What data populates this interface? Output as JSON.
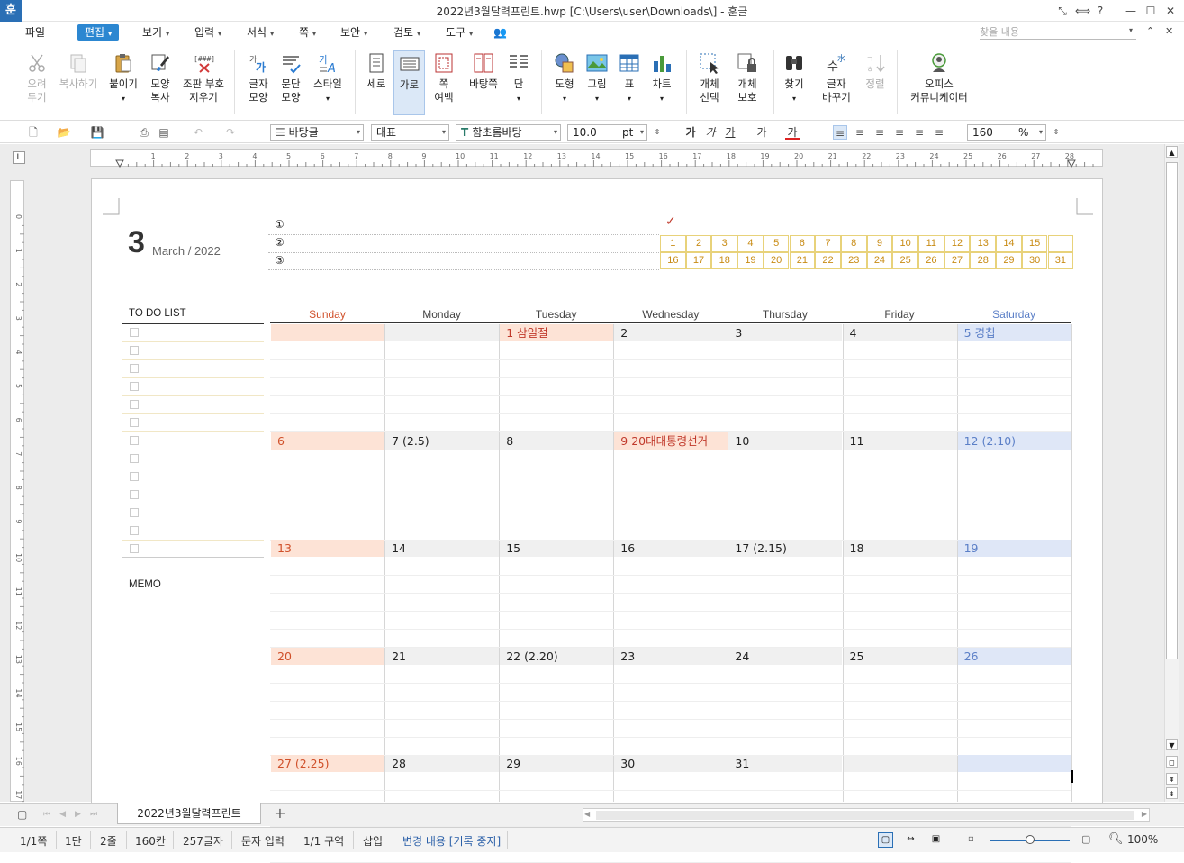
{
  "window": {
    "title": "2022년3월달력프린트.hwp [C:\\Users\\user\\Downloads\\] - 훈글",
    "app_icon": "훈"
  },
  "menu": {
    "items": [
      "파일",
      "편집",
      "보기",
      "입력",
      "서식",
      "쪽",
      "보안",
      "검토",
      "도구"
    ],
    "find_placeholder": "찾을 내용"
  },
  "ribbon": {
    "cut": "오려\n두기",
    "copy": "복사하기",
    "paste": "붙이기",
    "format_copy": "모양\n복사",
    "clear_marks": "조판 부호\n지우기",
    "char_shape": "글자\n모양",
    "para_shape": "문단\n모양",
    "style": "스타일",
    "portrait": "세로",
    "landscape": "가로",
    "margin": "쪽\n여백",
    "background": "바탕쪽",
    "columns": "단",
    "shape": "도형",
    "picture": "그림",
    "table": "표",
    "chart": "차트",
    "select_obj": "개체\n선택",
    "protect_obj": "개체\n보호",
    "find": "찾기",
    "replace": "글자\n바꾸기",
    "sort": "정렬",
    "office_comm": "오피스\n커뮤니케이터"
  },
  "toolbar": {
    "style_combo": "바탕글",
    "font_lang": "대표",
    "font_name": "함초롬바탕",
    "font_size": "10.0",
    "size_unit": "pt",
    "zoom": "160",
    "zoom_unit": "%"
  },
  "ruler_labels": [
    "1",
    "2",
    "3",
    "4",
    "5",
    "6",
    "7",
    "8",
    "9",
    "10",
    "11",
    "12",
    "13",
    "14",
    "15",
    "16",
    "17",
    "18",
    "19",
    "20",
    "21",
    "22",
    "23",
    "24",
    "25",
    "26",
    "27",
    "28"
  ],
  "vruler_labels": [
    "0",
    "1",
    "2",
    "3",
    "4",
    "5",
    "6",
    "7",
    "8",
    "9",
    "10",
    "11",
    "12",
    "13",
    "14",
    "15",
    "16",
    "17"
  ],
  "calendar": {
    "big_number": "3",
    "month_label": "March  /  2022",
    "goals": [
      "①",
      "②",
      "③"
    ],
    "check_mark": "✓",
    "tracker_row1": [
      "1",
      "2",
      "3",
      "4",
      "5",
      "6",
      "7",
      "8",
      "9",
      "10",
      "11",
      "12",
      "13",
      "14",
      "15",
      ""
    ],
    "tracker_row2": [
      "16",
      "17",
      "18",
      "19",
      "20",
      "21",
      "22",
      "23",
      "24",
      "25",
      "26",
      "27",
      "28",
      "29",
      "30",
      "31"
    ],
    "todo_title": "TO DO LIST",
    "memo_title": "MEMO",
    "days_of_week": [
      "Sunday",
      "Monday",
      "Tuesday",
      "Wednesday",
      "Thursday",
      "Friday",
      "Saturday"
    ],
    "weeks": [
      [
        "",
        "",
        "1  삼일절",
        "2",
        "3",
        "4",
        "5  경칩"
      ],
      [
        "6",
        "7  (2.5)",
        "8",
        "9  20대대통령선거",
        "10",
        "11",
        "12  (2.10)"
      ],
      [
        "13",
        "14",
        "15",
        "16",
        "17  (2.15)",
        "18",
        "19"
      ],
      [
        "20",
        "21",
        "22  (2.20)",
        "23",
        "24",
        "25",
        "26"
      ],
      [
        "27  (2.25)",
        "28",
        "29",
        "30",
        "31",
        "",
        ""
      ]
    ],
    "colors": {
      "sunday": "#d0502a",
      "saturday": "#5b7fc7",
      "holiday": "#c0392b",
      "sunday_bg": "#fde3d6",
      "saturday_bg": "#dfe7f7",
      "tracker": "#c88b14"
    }
  },
  "tabs": {
    "doc_tab": "2022년3월달력프린트",
    "add": "+"
  },
  "status": [
    "1/1쪽",
    "1단",
    "2줄",
    "160칸",
    "257글자",
    "문자 입력",
    "1/1 구역",
    "삽입",
    "변경 내용 [기록 중지]"
  ],
  "zoom_status": "100%"
}
